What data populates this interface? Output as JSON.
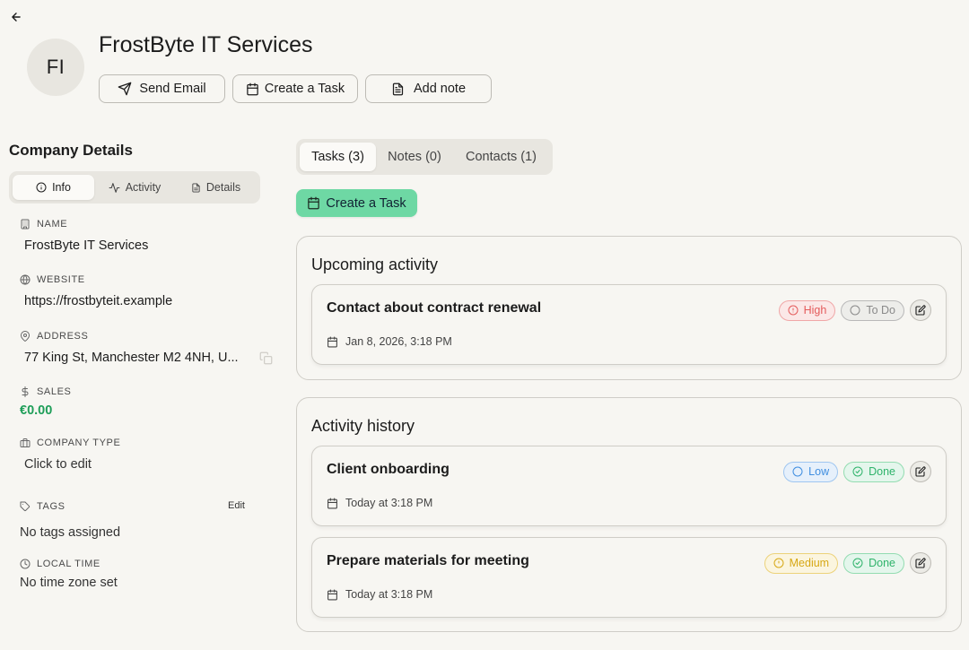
{
  "header": {
    "avatar_initials": "FI",
    "title": "FrostByte IT Services",
    "actions": {
      "send_email": "Send Email",
      "create_task": "Create a Task",
      "add_note": "Add note"
    }
  },
  "details": {
    "title": "Company Details",
    "tabs": {
      "info": "Info",
      "activity": "Activity",
      "details": "Details"
    },
    "fields": {
      "name_label": "NAME",
      "name_value": "FrostByte IT Services",
      "website_label": "WEBSITE",
      "website_value": "https://frostbyteit.example",
      "address_label": "ADDRESS",
      "address_value": "77 King St, Manchester M2 4NH, U...",
      "sales_label": "SALES",
      "sales_value": "€0.00",
      "company_type_label": "COMPANY TYPE",
      "company_type_value": "Click to edit",
      "tags_label": "TAGS",
      "tags_edit": "Edit",
      "tags_value": "No tags assigned",
      "local_time_label": "LOCAL TIME",
      "local_time_value": "No time zone set"
    }
  },
  "main": {
    "tabs": {
      "tasks": "Tasks (3)",
      "notes": "Notes (0)",
      "contacts": "Contacts (1)"
    },
    "create_task_label": "Create a Task",
    "upcoming": {
      "title": "Upcoming activity",
      "tasks": [
        {
          "title": "Contact about contract renewal",
          "date": "Jan 8, 2026, 3:18 PM",
          "priority": "High",
          "status": "To Do"
        }
      ]
    },
    "history": {
      "title": "Activity history",
      "tasks": [
        {
          "title": "Client onboarding",
          "date": "Today at 3:18 PM",
          "priority": "Low",
          "status": "Done"
        },
        {
          "title": "Prepare materials for meeting",
          "date": "Today at 3:18 PM",
          "priority": "Medium",
          "status": "Done"
        }
      ]
    }
  },
  "colors": {
    "accent_green": "#6ed8a4",
    "sales_green": "#1e9e58",
    "high": "#e45b5b",
    "low": "#3f8ee0",
    "medium": "#d7a815",
    "done": "#2fb36b"
  },
  "icons": [
    "arrow-left-icon",
    "send-icon",
    "calendar-icon",
    "file-text-icon",
    "info-icon",
    "activity-icon",
    "building-icon",
    "globe-icon",
    "map-pin-icon",
    "dollar-icon",
    "briefcase-icon",
    "tag-icon",
    "clock-icon",
    "copy-icon",
    "alert-circle-icon",
    "circle-icon",
    "check-circle-icon",
    "edit-icon"
  ]
}
